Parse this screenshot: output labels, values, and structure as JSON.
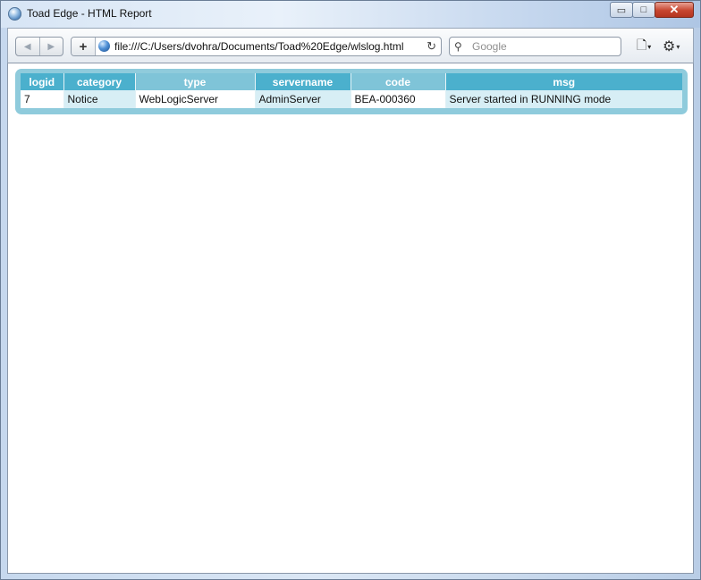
{
  "window": {
    "title": "Toad Edge - HTML Report",
    "controls": {
      "minimize": "▭",
      "maximize": "□",
      "close": "✕"
    }
  },
  "toolbar": {
    "back_icon": "◀",
    "forward_icon": "▶",
    "add_icon": "+",
    "url": "file:///C:/Users/dvohra/Documents/Toad%20Edge/wlslog.html",
    "reload_icon": "↻",
    "search_placeholder": "Google",
    "search_icon": "⚲",
    "page_icon": "🗋",
    "gear_icon": "⚙",
    "caret": "▾"
  },
  "report": {
    "columns": [
      "logid",
      "category",
      "type",
      "servername",
      "code",
      "msg"
    ],
    "rows": [
      [
        "7",
        "Notice",
        "WebLogicServer",
        "AdminServer",
        "BEA-000360",
        "Server started in RUNNING mode"
      ]
    ]
  },
  "colors": {
    "header_dark": "#4bb0cd",
    "header_light": "#7fc4d8",
    "frame": "#8fcbdc",
    "cell_alt": "#d7eef5"
  }
}
